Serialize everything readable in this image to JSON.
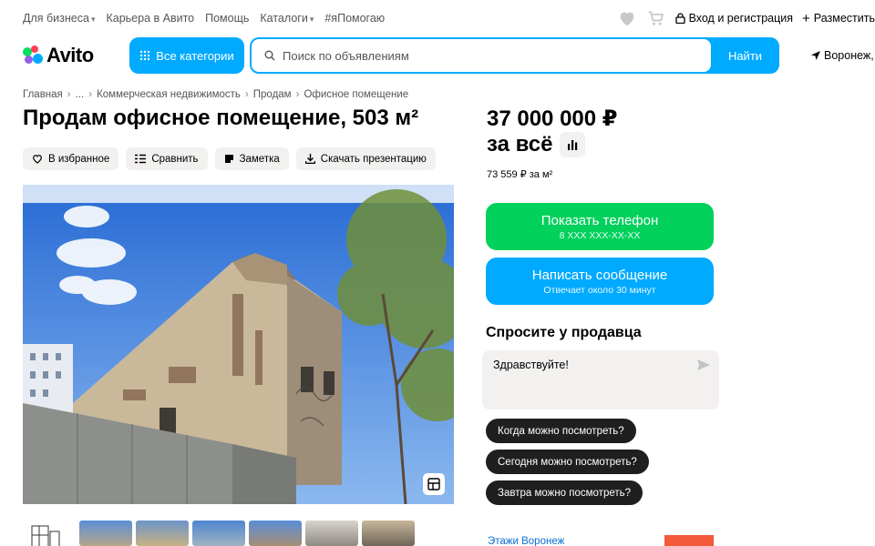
{
  "topbar": {
    "links": [
      "Для бизнеса",
      "Карьера в Авито",
      "Помощь",
      "Каталоги",
      "#яПомогаю"
    ],
    "login": "Вход и регистрация",
    "post": "Разместить"
  },
  "header": {
    "logo": "Avito",
    "categories_button": "Все категории",
    "search_placeholder": "Поиск по объявлениям",
    "search_button": "Найти",
    "city": "Воронеж,"
  },
  "breadcrumb": [
    "Главная",
    "...",
    "Коммерческая недвижимость",
    "Продам",
    "Офисное помещение"
  ],
  "listing": {
    "title": "Продам офисное помещение, 503 м²",
    "actions": [
      "В избранное",
      "Сравнить",
      "Заметка",
      "Скачать презентацию"
    ]
  },
  "price": {
    "amount": "37 000 000 ₽",
    "qualifier": "за всё",
    "per_m": "73 559 ₽ за м²"
  },
  "contact": {
    "phone_label": "Показать телефон",
    "phone_mask": "8 XXX XXX-XX-XX",
    "message_label": "Написать сообщение",
    "message_sub": "Отвечает около 30 минут"
  },
  "ask": {
    "title": "Спросите у продавца",
    "message": "Здравствуйте!",
    "chips": [
      "Когда можно посмотреть?",
      "Сегодня можно посмотреть?",
      "Завтра можно посмотреть?"
    ]
  },
  "footer_link": "Этажи Воронеж",
  "colors": {
    "accent": "#00aaff",
    "phone_green": "#02d15c",
    "chip_dark": "#1f1f1f",
    "bg_gray": "#f2f1f0"
  }
}
